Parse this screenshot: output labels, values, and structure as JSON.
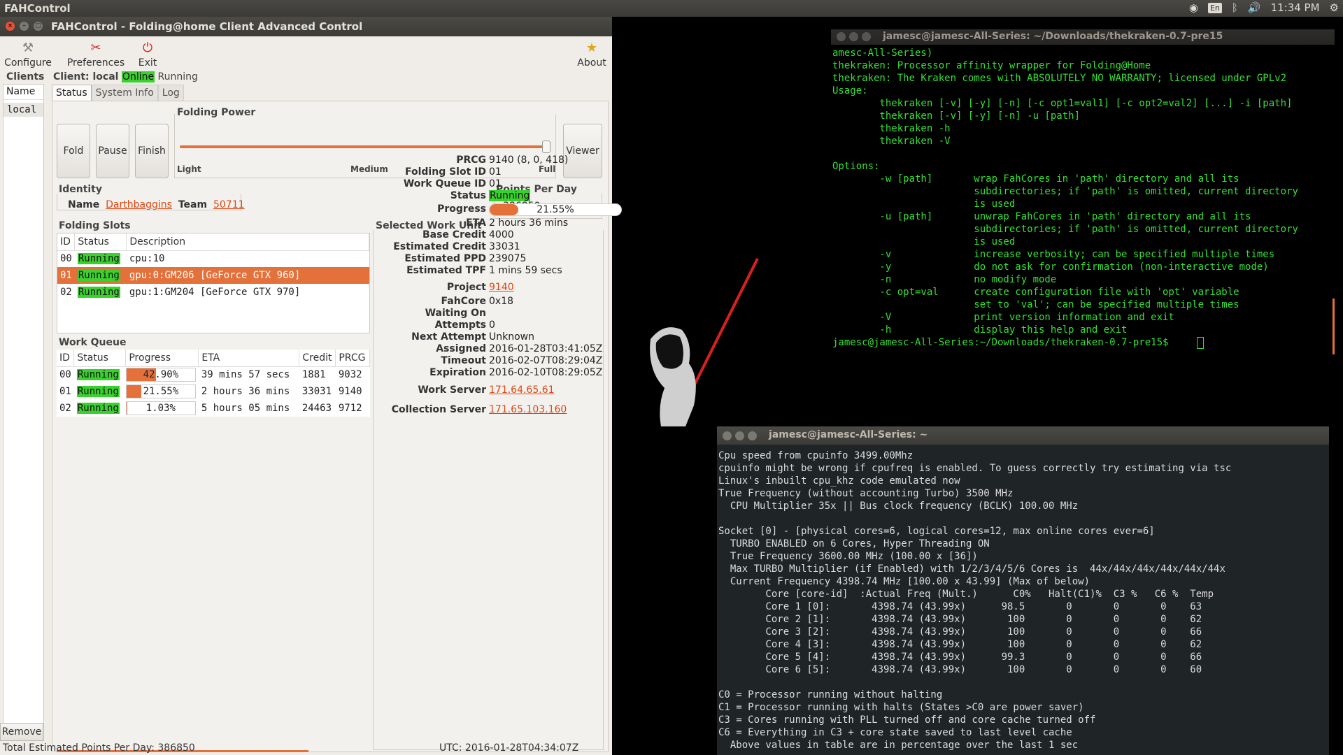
{
  "topbar": {
    "app": "FAHControl",
    "kb": "En",
    "time": "11:34 PM"
  },
  "window": {
    "title": "FAHControl - Folding@home Client Advanced Control"
  },
  "toolbar": {
    "configure": "Configure",
    "preferences": "Preferences",
    "exit": "Exit",
    "about": "About"
  },
  "client": {
    "label": "Client: local",
    "online": "Online",
    "running": "Running"
  },
  "clients": {
    "header": "Clients",
    "name_col": "Name",
    "items": [
      "local"
    ],
    "remove": "Remove"
  },
  "tabs": [
    "Status",
    "System Info",
    "Log"
  ],
  "controls": {
    "fold": "Fold",
    "pause": "Pause",
    "finish": "Finish",
    "viewer": "Viewer",
    "power_title": "Folding Power",
    "light": "Light",
    "medium": "Medium",
    "full": "Full",
    "power_level": 1.0
  },
  "identity": {
    "title": "Identity",
    "name_label": "Name",
    "name": "Darthbaggins",
    "team_label": "Team",
    "team": "50711"
  },
  "ppd": {
    "title": "Points Per Day",
    "value": "386850"
  },
  "slots": {
    "title": "Folding Slots",
    "cols": [
      "ID",
      "Status",
      "Description"
    ],
    "rows": [
      {
        "id": "00",
        "status": "Running",
        "desc": "cpu:10"
      },
      {
        "id": "01",
        "status": "Running",
        "desc": "gpu:0:GM206 [GeForce GTX 960]"
      },
      {
        "id": "02",
        "status": "Running",
        "desc": "gpu:1:GM204 [GeForce GTX 970]"
      }
    ]
  },
  "queue": {
    "title": "Work Queue",
    "cols": [
      "ID",
      "Status",
      "Progress",
      "ETA",
      "Credit",
      "PRCG"
    ],
    "rows": [
      {
        "id": "00",
        "status": "Running",
        "progress": "42.90%",
        "pct": 0.429,
        "eta": "39 mins 57 secs",
        "credit": "1881",
        "prcg": "9032"
      },
      {
        "id": "01",
        "status": "Running",
        "progress": "21.55%",
        "pct": 0.2155,
        "eta": "2 hours 36 mins",
        "credit": "33031",
        "prcg": "9140"
      },
      {
        "id": "02",
        "status": "Running",
        "progress": "1.03%",
        "pct": 0.0103,
        "eta": "5 hours 05 mins",
        "credit": "24463",
        "prcg": "9712"
      }
    ]
  },
  "wu": {
    "title": "Selected Work Unit",
    "prcg_l": "PRCG",
    "prcg": "9140 (8, 0, 418)",
    "slot_l": "Folding Slot ID",
    "slot": "01",
    "queue_l": "Work Queue ID",
    "queue": "01",
    "status_l": "Status",
    "status": "Running",
    "progress_l": "Progress",
    "progress": "21.55%",
    "pct": 0.2155,
    "eta_l": "ETA",
    "eta": "2 hours 36 mins",
    "base_l": "Base Credit",
    "base": "4000",
    "est_l": "Estimated Credit",
    "est": "33031",
    "ppd_l": "Estimated PPD",
    "ppd": "239075",
    "tpf_l": "Estimated TPF",
    "tpf": "1 mins 59 secs",
    "project_l": "Project",
    "project": "9140",
    "core_l": "FahCore",
    "core": "0x18",
    "waiting_l": "Waiting On",
    "waiting": "",
    "attempts_l": "Attempts",
    "attempts": "0",
    "next_l": "Next Attempt",
    "next": "Unknown",
    "assigned_l": "Assigned",
    "assigned": "2016-01-28T03:41:05Z",
    "timeout_l": "Timeout",
    "timeout": "2016-02-07T08:29:04Z",
    "expiration_l": "Expiration",
    "expiration": "2016-02-10T08:29:05Z",
    "ws_l": "Work Server",
    "ws": "171.64.65.61",
    "cs_l": "Collection Server",
    "cs": "171.65.103.160"
  },
  "statusbar": {
    "total": "Total Estimated Points Per Day: 386850",
    "utc": "UTC: 2016-01-28T04:34:07Z"
  },
  "term1": {
    "title": "jamesc@jamesc-All-Series: ~/Downloads/thekraken-0.7-pre15",
    "lines": [
      "amesc-All-Series)",
      "thekraken: Processor affinity wrapper for Folding@Home",
      "thekraken: The Kraken comes with ABSOLUTELY NO WARRANTY; licensed under GPLv2",
      "Usage:",
      "        thekraken [-v] [-y] [-n] [-c opt1=val1] [-c opt2=val2] [...] -i [path]",
      "        thekraken [-v] [-y] [-n] -u [path]",
      "        thekraken -h",
      "        thekraken -V",
      "",
      "Options:",
      "        -w [path]       wrap FahCores in 'path' directory and all its",
      "                        subdirectories; if 'path' is omitted, current directory",
      "                        is used",
      "        -u [path]       unwrap FahCores in 'path' directory and all its",
      "                        subdirectories; if 'path' is omitted, current directory",
      "                        is used",
      "        -v              increase verbosity; can be specified multiple times",
      "        -y              do not ask for confirmation (non-interactive mode)",
      "        -n              no modify mode",
      "        -c opt=val      create configuration file with 'opt' variable",
      "                        set to 'val'; can be specified multiple times",
      "        -V              print version information and exit",
      "        -h              display this help and exit",
      "jamesc@jamesc-All-Series:~/Downloads/thekraken-0.7-pre15$ "
    ]
  },
  "term2": {
    "title": "jamesc@jamesc-All-Series: ~",
    "lines": [
      "Cpu speed from cpuinfo 3499.00Mhz",
      "cpuinfo might be wrong if cpufreq is enabled. To guess correctly try estimating via tsc",
      "Linux's inbuilt cpu_khz code emulated now",
      "True Frequency (without accounting Turbo) 3500 MHz",
      "  CPU Multiplier 35x || Bus clock frequency (BCLK) 100.00 MHz",
      "",
      "Socket [0] - [physical cores=6, logical cores=12, max online cores ever=6]",
      "  TURBO ENABLED on 6 Cores, Hyper Threading ON",
      "  True Frequency 3600.00 MHz (100.00 x [36])",
      "  Max TURBO Multiplier (if Enabled) with 1/2/3/4/5/6 Cores is  44x/44x/44x/44x/44x/44x",
      "  Current Frequency 4398.74 MHz [100.00 x 43.99] (Max of below)",
      "        Core [core-id]  :Actual Freq (Mult.)      C0%   Halt(C1)%  C3 %   C6 %  Temp",
      "        Core 1 [0]:       4398.74 (43.99x)      98.5       0       0       0    63",
      "        Core 2 [1]:       4398.74 (43.99x)       100       0       0       0    62",
      "        Core 3 [2]:       4398.74 (43.99x)       100       0       0       0    66",
      "        Core 4 [3]:       4398.74 (43.99x)       100       0       0       0    62",
      "        Core 5 [4]:       4398.74 (43.99x)      99.3       0       0       0    66",
      "        Core 6 [5]:       4398.74 (43.99x)       100       0       0       0    60",
      "",
      "C0 = Processor running without halting",
      "C1 = Processor running with halts (States >C0 are power saver)",
      "C3 = Cores running with PLL turned off and core cache turned off",
      "C6 = Everything in C3 + core state saved to last level cache",
      "  Above values in table are in percentage over the last 1 sec"
    ]
  }
}
